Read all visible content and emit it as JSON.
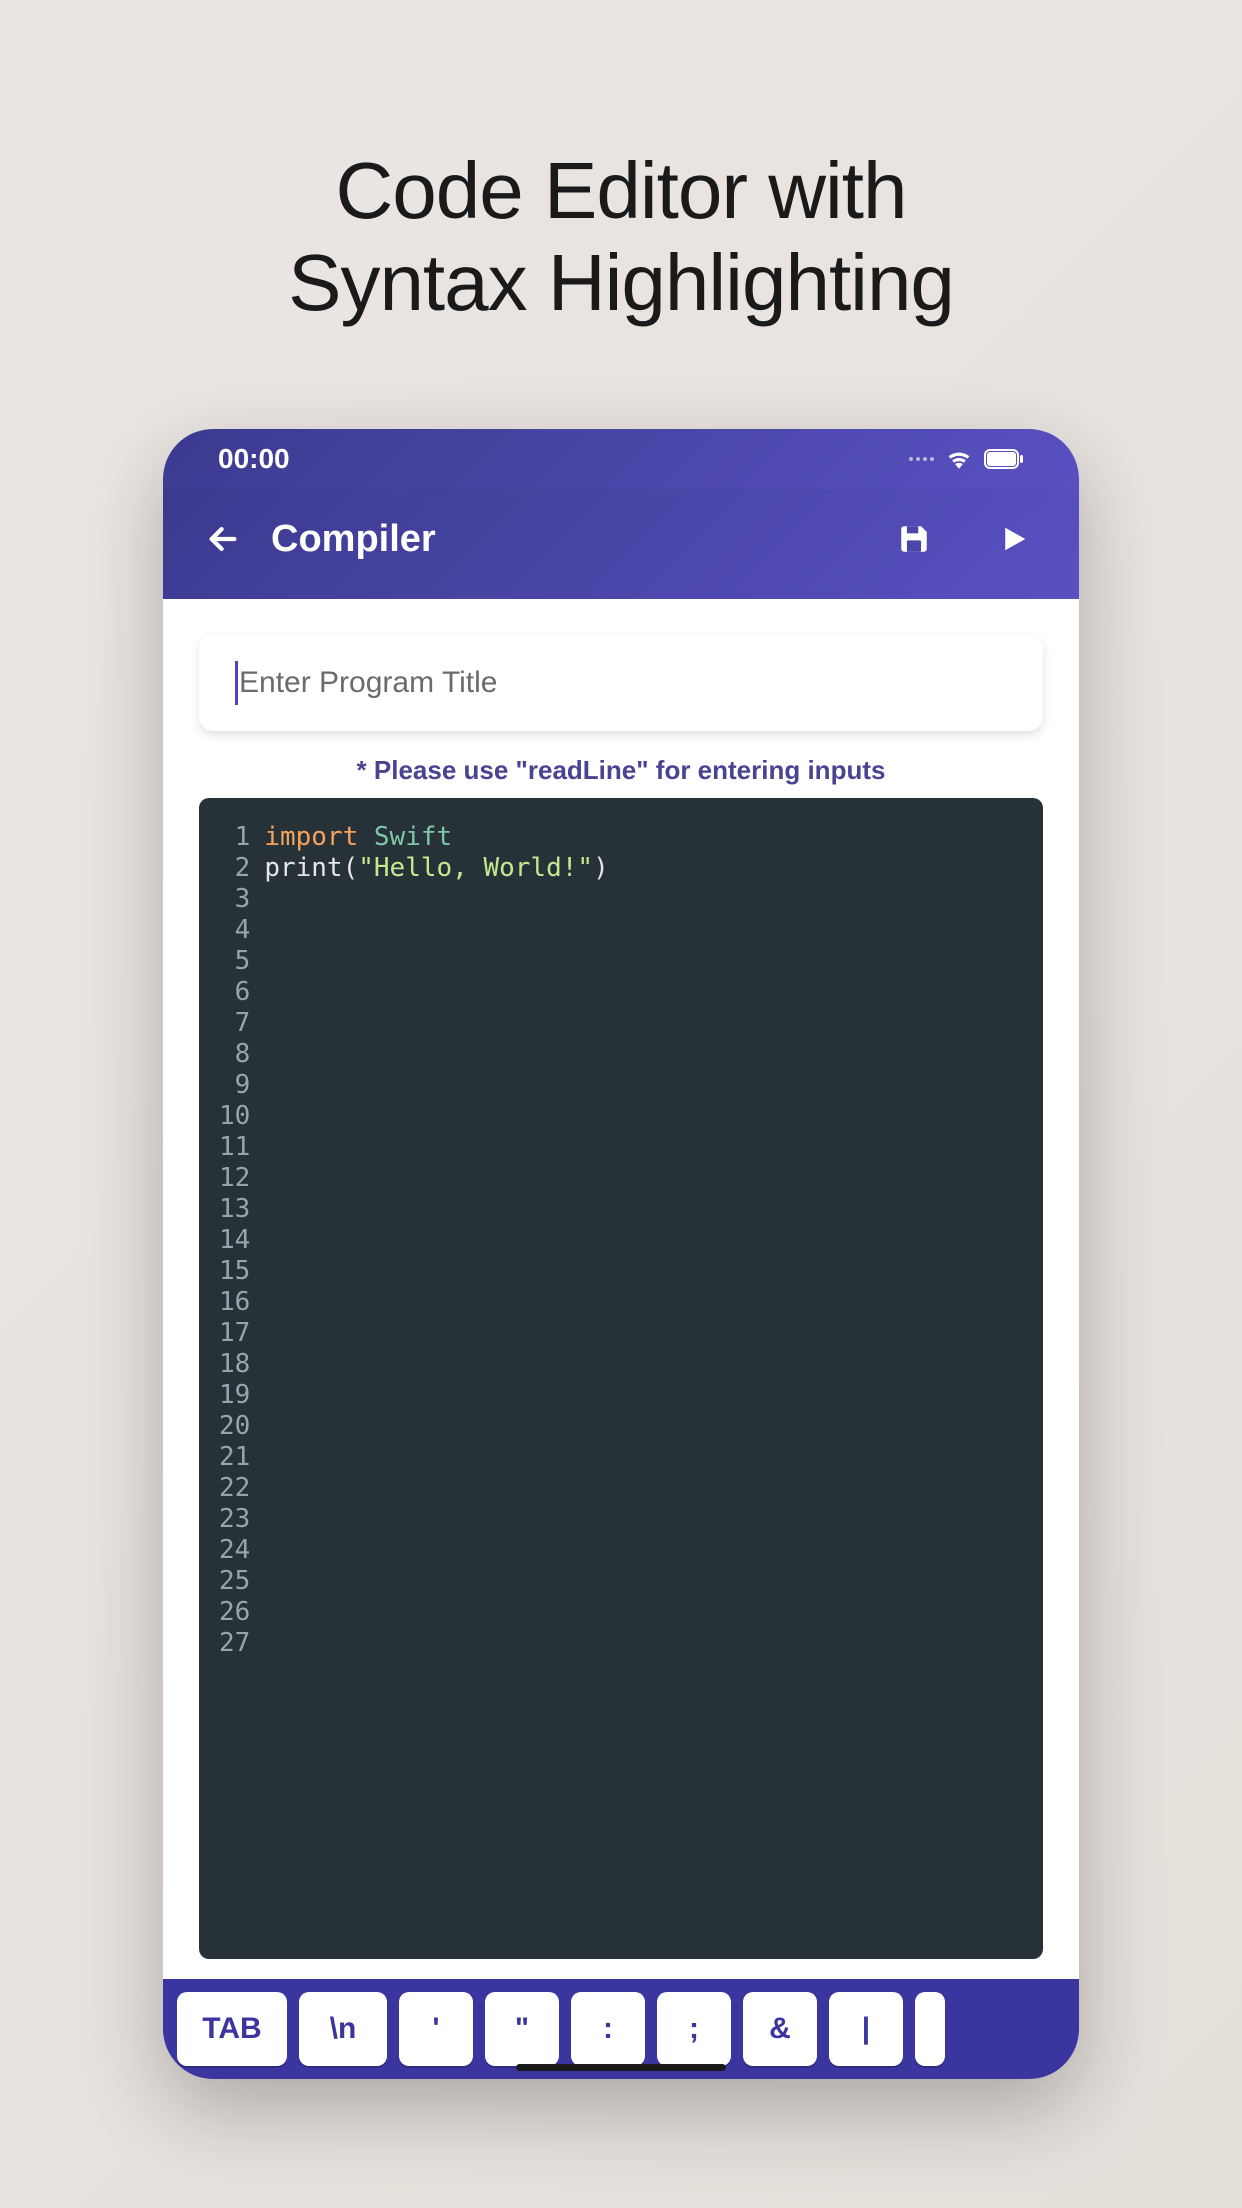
{
  "marketing": {
    "title_line1": "Code Editor with",
    "title_line2": "Syntax Highlighting"
  },
  "status_bar": {
    "time": "00:00"
  },
  "nav": {
    "title": "Compiler"
  },
  "title_input": {
    "placeholder": "Enter Program Title",
    "value": ""
  },
  "hint": "* Please use \"readLine\" for entering inputs",
  "editor": {
    "line_count": 27,
    "code_lines": [
      {
        "tokens": [
          {
            "t": "import",
            "c": "kw"
          },
          {
            "t": " ",
            "c": ""
          },
          {
            "t": "Swift",
            "c": "type"
          }
        ]
      },
      {
        "tokens": [
          {
            "t": "print",
            "c": "fn"
          },
          {
            "t": "(",
            "c": "punct"
          },
          {
            "t": "\"Hello, World!\"",
            "c": "str"
          },
          {
            "t": ")",
            "c": "punct"
          }
        ]
      }
    ]
  },
  "keyboard_keys": [
    "TAB",
    "\\n",
    "'",
    "\"",
    ":",
    ";",
    "&",
    "|"
  ],
  "colors": {
    "header_gradient_from": "#3b3a8f",
    "header_gradient_to": "#5950c2",
    "editor_bg": "#263238"
  }
}
